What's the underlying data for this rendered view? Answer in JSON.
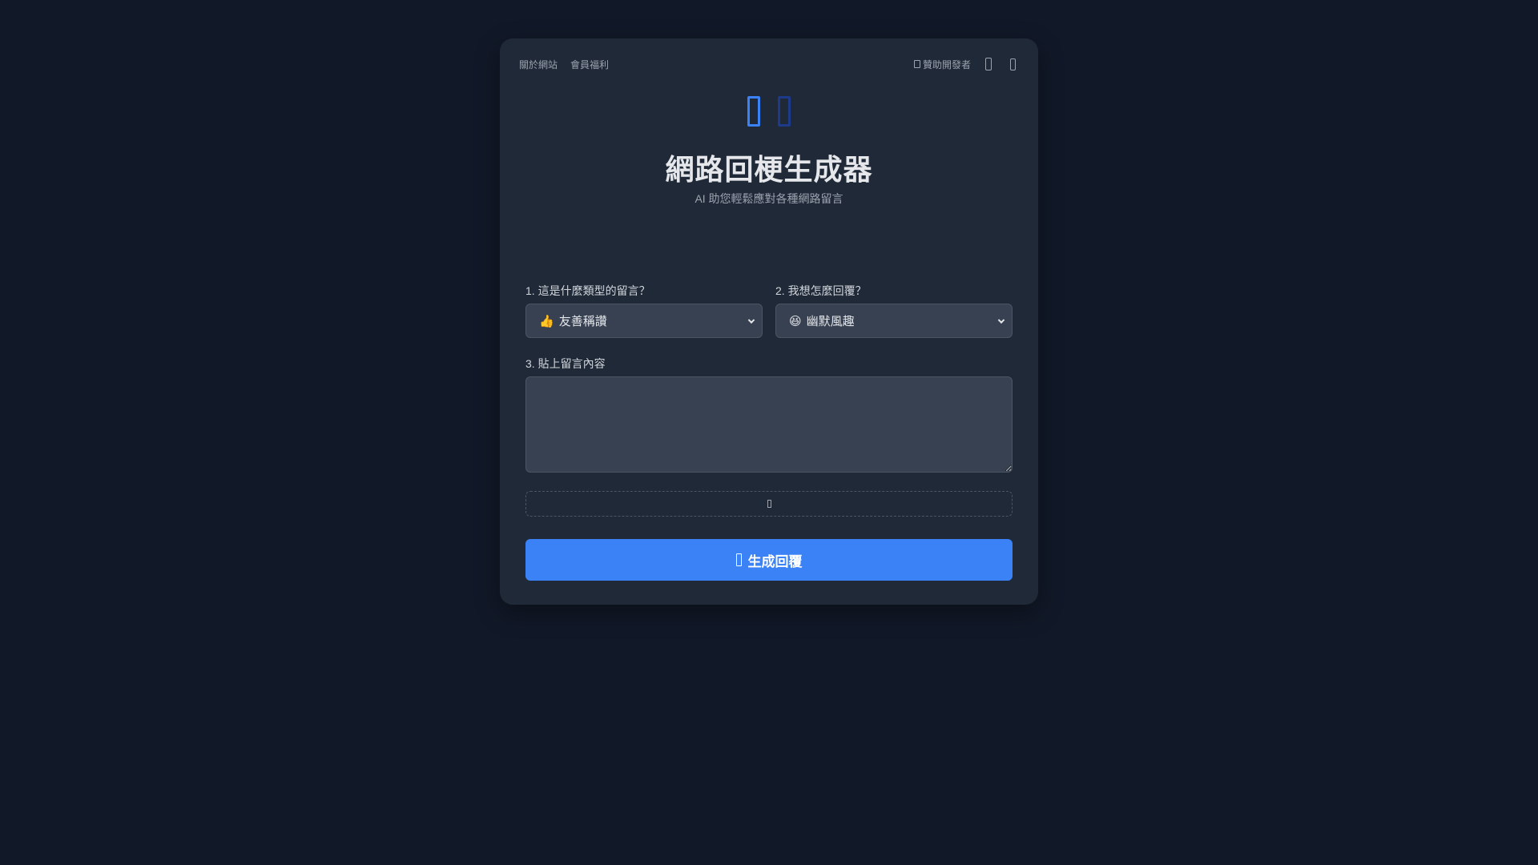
{
  "nav": {
    "about": "關於網站",
    "benefits": "會員福利",
    "sponsor": "贊助開發者"
  },
  "header": {
    "title": "網路回梗生成器",
    "subtitle": "AI 助您輕鬆應對各種網路留言"
  },
  "form": {
    "type_label": "1. 這是什麼類型的留言？",
    "type_selected_emoji": "👍",
    "type_selected": "友善稱讚",
    "style_label": "2. 我想怎麼回覆？",
    "style_selected_emoji": "😆",
    "style_selected": "幽默風趣",
    "content_label": "3. 貼上留言內容",
    "content_value": "",
    "generate_label": "生成回覆"
  },
  "icons": {
    "logo_primary": "logo-icon",
    "logo_secondary": "logo-secondary-icon",
    "sponsor": "heart-icon",
    "theme": "theme-toggle-icon",
    "settings": "settings-icon",
    "attach": "image-upload-icon",
    "generate": "sparkle-icon"
  },
  "colors": {
    "background": "#111827",
    "card": "#1f2937",
    "input": "#374151",
    "accent": "#3b82f6"
  }
}
